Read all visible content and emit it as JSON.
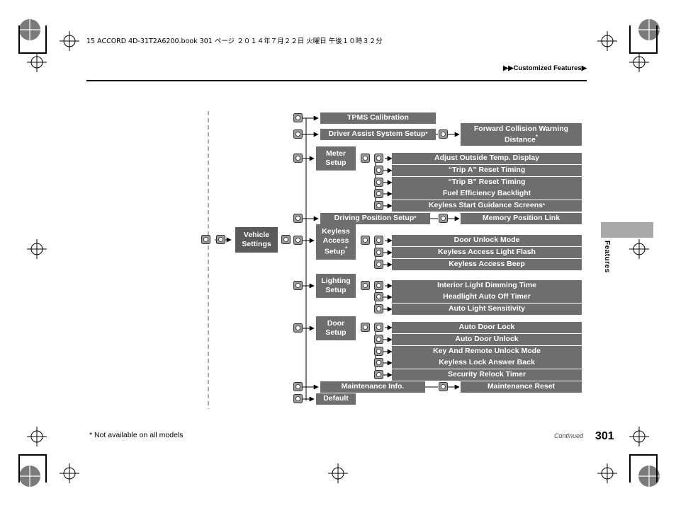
{
  "header": {
    "bookline": "15 ACCORD 4D-31T2A6200.book   301 ページ   ２０１４年７月２２日   火曜日   午後１０時３２分",
    "section": "▶▶Customized Features▶"
  },
  "side_tab": {
    "label": "Features"
  },
  "footer": {
    "footnote": "* Not available on all models",
    "continued": "Continued",
    "page_number": "301"
  },
  "diagram": {
    "root": "Vehicle\nSettings",
    "nodes": {
      "root": {
        "line1": "Vehicle",
        "line2": "Settings"
      },
      "tpms": "TPMS Calibration",
      "driver_assist": "Driver Assist System Setup",
      "driver_assist_star": "*",
      "fcw": {
        "line1": "Forward Collision Warning",
        "line2": "Distance",
        "star": "*"
      },
      "meter_setup": {
        "line1": "Meter",
        "line2": "Setup"
      },
      "adjust_outside_temp": "Adjust Outside Temp. Display",
      "trip_a": "“Trip A” Reset Timing",
      "trip_b": "“Trip B” Reset Timing",
      "fuel_eff": "Fuel Efficiency Backlight",
      "keyless_start_guidance": "Keyless Start Guidance Screens",
      "keyless_start_guidance_star": "*",
      "driving_position": "Driving Position Setup",
      "driving_position_star": "*",
      "memory_position": "Memory Position Link",
      "keyless_access_setup": {
        "line1": "Keyless",
        "line2": "Access",
        "line3": "Setup",
        "star": "*"
      },
      "door_unlock_mode": "Door Unlock Mode",
      "keyless_light_flash": "Keyless Access Light Flash",
      "keyless_beep": "Keyless Access Beep",
      "lighting_setup": {
        "line1": "Lighting",
        "line2": "Setup"
      },
      "interior_dimming": "Interior Light Dimming Time",
      "headlight_auto_off": "Headlight Auto Off Timer",
      "auto_light_sensitivity": "Auto Light Sensitivity",
      "door_setup": {
        "line1": "Door",
        "line2": "Setup"
      },
      "auto_door_lock": "Auto Door Lock",
      "auto_door_unlock": "Auto Door Unlock",
      "key_remote_unlock": "Key And Remote Unlock Mode",
      "keyless_lock_answer": "Keyless Lock Answer Back",
      "security_relock": "Security Relock Timer",
      "maintenance_info": "Maintenance Info.",
      "maintenance_reset": "Maintenance Reset",
      "default": "Default"
    },
    "icons": {
      "selector_wheel": "selector-knob-icon",
      "enter_button": "enter-button-icon",
      "arrow": "arrow-right-icon"
    }
  }
}
